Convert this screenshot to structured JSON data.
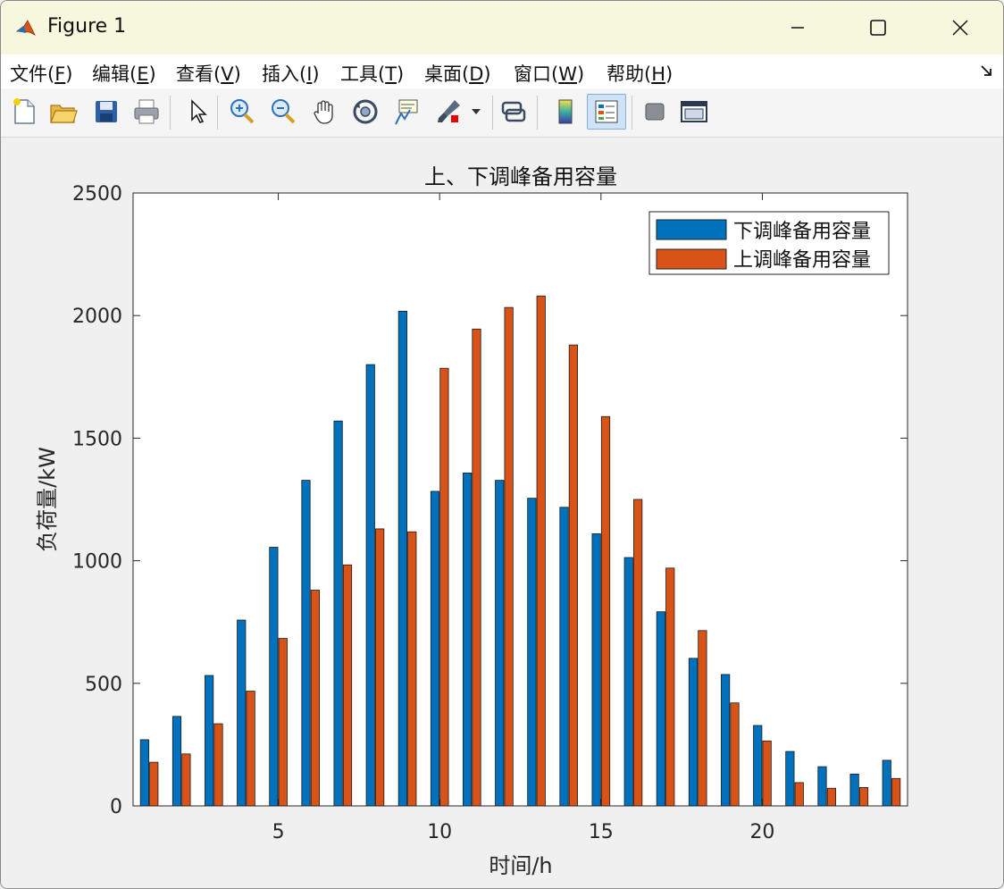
{
  "window": {
    "title": "Figure 1"
  },
  "menu": {
    "items": [
      {
        "text": "文件(",
        "key": "F",
        "end": ")"
      },
      {
        "text": "编辑(",
        "key": "E",
        "end": ")"
      },
      {
        "text": "查看(",
        "key": "V",
        "end": ")"
      },
      {
        "text": "插入(",
        "key": "I",
        "end": ")"
      },
      {
        "text": "工具(",
        "key": "T",
        "end": ")"
      },
      {
        "text": "桌面(",
        "key": "D",
        "end": ")"
      },
      {
        "text": "窗口(",
        "key": "W",
        "end": ")"
      },
      {
        "text": "帮助(",
        "key": "H",
        "end": ")"
      }
    ]
  },
  "toolbar": {
    "icons": [
      "new-file-icon",
      "open-folder-icon",
      "save-icon",
      "print-icon",
      "pointer-icon",
      "zoom-in-icon",
      "zoom-out-icon",
      "pan-hand-icon",
      "rotate-3d-icon",
      "data-tips-icon",
      "brush-icon",
      "link-plot-icon",
      "colorbar-icon",
      "legend-icon",
      "hide-tools-icon",
      "dock-icon"
    ]
  },
  "colors": {
    "series_down": "#0072BD",
    "series_up": "#D95319"
  },
  "chart_data": {
    "type": "bar",
    "title": "上、下调峰备用容量",
    "xlabel": "时间/h",
    "ylabel": "负荷量/kW",
    "xlim": [
      0.5,
      24.5
    ],
    "ylim": [
      0,
      2500
    ],
    "xticks": [
      5,
      10,
      15,
      20
    ],
    "yticks": [
      0,
      500,
      1000,
      1500,
      2000,
      2500
    ],
    "grid": false,
    "legend_location": "northeast",
    "categories": [
      1,
      2,
      3,
      4,
      5,
      6,
      7,
      8,
      9,
      10,
      11,
      12,
      13,
      14,
      15,
      16,
      17,
      18,
      19,
      20,
      21,
      22,
      23,
      24
    ],
    "series": [
      {
        "name": "下调峰备用容量",
        "color": "#0072BD",
        "values": [
          270,
          365,
          532,
          758,
          1055,
          1328,
          1570,
          1800,
          2018,
          1283,
          1358,
          1328,
          1255,
          1218,
          1110,
          1013,
          792,
          602,
          536,
          328,
          222,
          160,
          130,
          186
        ]
      },
      {
        "name": "上调峰备用容量",
        "color": "#D95319",
        "values": [
          178,
          212,
          335,
          468,
          683,
          880,
          983,
          1130,
          1118,
          1785,
          1945,
          2033,
          2080,
          1880,
          1588,
          1250,
          970,
          715,
          420,
          265,
          95,
          72,
          75,
          112
        ]
      }
    ]
  }
}
